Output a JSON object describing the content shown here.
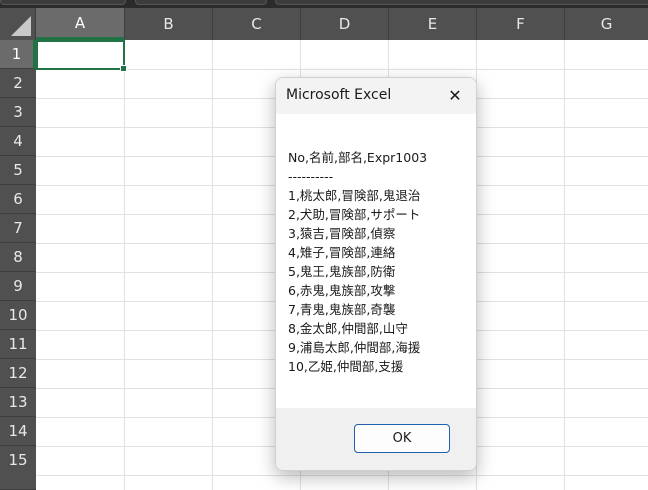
{
  "spreadsheet": {
    "columns": [
      "A",
      "B",
      "C",
      "D",
      "E",
      "F",
      "G"
    ],
    "rows": [
      "1",
      "2",
      "3",
      "4",
      "5",
      "6",
      "7",
      "8",
      "9",
      "10",
      "11",
      "12",
      "13",
      "14",
      "15"
    ],
    "selected_cell": "A1",
    "accent_color": "#217346",
    "header_bg": "#505050"
  },
  "dialog": {
    "title": "Microsoft Excel",
    "close_glyph": "✕",
    "message_lines": [
      "No,名前,部名,Expr1003",
      "----------",
      "1,桃太郎,冒険部,鬼退治",
      "2,犬助,冒険部,サポート",
      "3,猿吉,冒険部,偵察",
      "4,雉子,冒険部,連絡",
      "5,鬼王,鬼族部,防衛",
      "6,赤鬼,鬼族部,攻撃",
      "7,青鬼,鬼族部,奇襲",
      "8,金太郎,仲間部,山守",
      "9,浦島太郎,仲間部,海援",
      "10,乙姫,仲間部,支援"
    ],
    "ok_label": "OK",
    "button_border_color": "#1f5fae"
  }
}
